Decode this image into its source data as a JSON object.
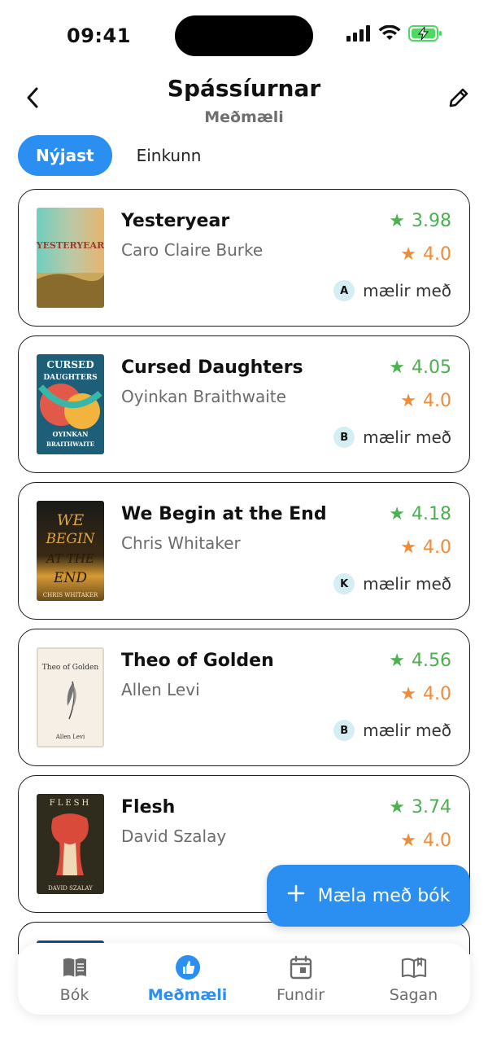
{
  "status_bar": {
    "time": "09:41"
  },
  "header": {
    "title": "Spássíurnar",
    "subtitle": "Meðmæli",
    "back_icon": "chevron-left-icon",
    "edit_icon": "pencil-icon"
  },
  "sort_tabs": [
    {
      "label": "Nýjast",
      "active": true
    },
    {
      "label": "Einkunn",
      "active": false
    }
  ],
  "books": [
    {
      "title": "Yesteryear",
      "author": "Caro Claire Burke",
      "goodreads_rating": "3.98",
      "club_rating": "4.0",
      "recommender_initial": "A",
      "recommend_label": "mælir með",
      "cover_text": "YESTERYEAR"
    },
    {
      "title": "Cursed Daughters",
      "author": "Oyinkan Braithwaite",
      "goodreads_rating": "4.05",
      "club_rating": "4.0",
      "recommender_initial": "B",
      "recommend_label": "mælir með",
      "cover_text": "CURSED DAUGHTERS"
    },
    {
      "title": "We Begin at the End",
      "author": "Chris Whitaker",
      "goodreads_rating": "4.18",
      "club_rating": "4.0",
      "recommender_initial": "K",
      "recommend_label": "mælir með",
      "cover_text": "WE BEGIN AT THE END"
    },
    {
      "title": "Theo of Golden",
      "author": "Allen Levi",
      "goodreads_rating": "4.56",
      "club_rating": "4.0",
      "recommender_initial": "B",
      "recommend_label": "mælir með",
      "cover_text": "Theo of Golden"
    },
    {
      "title": "Flesh",
      "author": "David Szalay",
      "goodreads_rating": "3.74",
      "club_rating": "4.0",
      "recommender_initial": "",
      "recommend_label": "",
      "cover_text": "FLESH"
    }
  ],
  "fab": {
    "label": "Mæla með bók",
    "icon": "plus-icon"
  },
  "bottom_nav": [
    {
      "label": "Bók",
      "icon": "book-open-icon",
      "active": false
    },
    {
      "label": "Meðmæli",
      "icon": "thumbs-up-icon",
      "active": true
    },
    {
      "label": "Fundir",
      "icon": "calendar-icon",
      "active": false
    },
    {
      "label": "Sagan",
      "icon": "book-history-icon",
      "active": false
    }
  ],
  "colors": {
    "accent": "#2b8ff2",
    "goodreads_green": "#4caf50",
    "club_orange": "#ef8c3a",
    "avatar_bg": "#d5eef4"
  }
}
